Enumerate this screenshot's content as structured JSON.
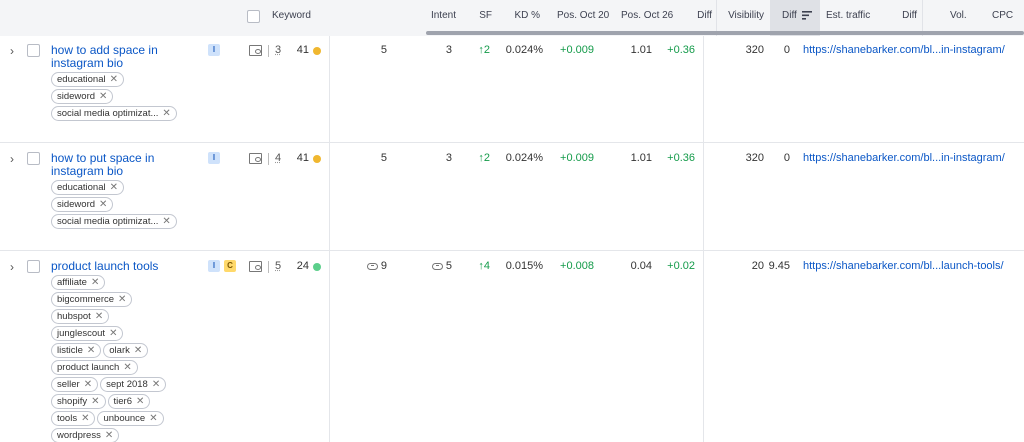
{
  "header": {
    "keyword": "Keyword",
    "intent": "Intent",
    "sf": "SF",
    "kd": "KD %",
    "pos_oct20": "Pos. Oct 20",
    "pos_oct26": "Pos. Oct 26",
    "diff1": "Diff",
    "visibility": "Visibility",
    "diff2": "Diff",
    "est_traffic": "Est. traffic",
    "diff3": "Diff",
    "vol": "Vol.",
    "cpc": "CPC",
    "sort_icon": "sort-descending-icon"
  },
  "rows": [
    {
      "keyword": "how to add space in instagram bio",
      "tags": [
        "educational",
        "sideword",
        "social media optimizat..."
      ],
      "intent": [
        "I"
      ],
      "pos": "3",
      "kd": "41",
      "kd_color": "#f0b72f",
      "intent_count": "5",
      "sf": "3",
      "sf_diff": "↑2",
      "kd_pct": "0.024%",
      "kd_pct_diff": "+0.009",
      "pos_oct26": "1.01",
      "pos_diff": "+0.36",
      "visibility": "320",
      "vis_diff": "0",
      "url": "https://shanebarker.com/bl...in-instagram/",
      "intent_link": false,
      "sf_link": false
    },
    {
      "keyword": "how to put space in instagram bio",
      "tags": [
        "educational",
        "sideword",
        "social media optimizat..."
      ],
      "intent": [
        "I"
      ],
      "pos": "4",
      "kd": "41",
      "kd_color": "#f0b72f",
      "intent_count": "5",
      "sf": "3",
      "sf_diff": "↑2",
      "kd_pct": "0.024%",
      "kd_pct_diff": "+0.009",
      "pos_oct26": "1.01",
      "pos_diff": "+0.36",
      "visibility": "320",
      "vis_diff": "0",
      "url": "https://shanebarker.com/bl...in-instagram/",
      "intent_link": false,
      "sf_link": false
    },
    {
      "keyword": "product launch tools",
      "tags": [
        "affiliate",
        "bigcommerce",
        "hubspot",
        "junglescout",
        "listicle",
        "olark",
        "product launch",
        "seller",
        "sept 2018",
        "shopify",
        "tier6",
        "tools",
        "unbounce",
        "wordpress"
      ],
      "intent": [
        "I",
        "C"
      ],
      "pos": "5",
      "kd": "24",
      "kd_color": "#5ccf8b",
      "intent_count": "9",
      "sf": "5",
      "sf_diff": "↑4",
      "kd_pct": "0.015%",
      "kd_pct_diff": "+0.008",
      "pos_oct26": "0.04",
      "pos_diff": "+0.02",
      "visibility": "20",
      "vis_diff": "9.45",
      "url": "https://shanebarker.com/bl...launch-tools/",
      "intent_link": true,
      "sf_link": true
    }
  ]
}
